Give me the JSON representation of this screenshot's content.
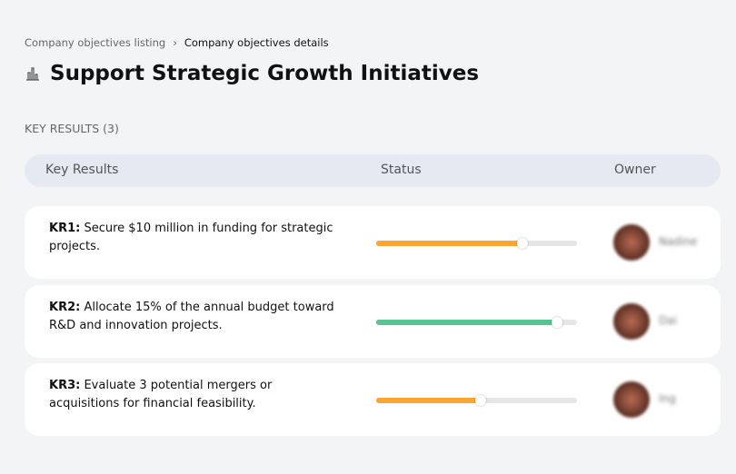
{
  "breadcrumb": {
    "parent": "Company objectives listing",
    "separator": "›",
    "current": "Company objectives details"
  },
  "page": {
    "title": "Support Strategic Growth Initiatives",
    "icon": "bar-chart-icon"
  },
  "section": {
    "label": "KEY RESULTS (3)"
  },
  "table": {
    "headers": {
      "key_results": "Key Results",
      "status": "Status",
      "owner": "Owner"
    }
  },
  "key_results": [
    {
      "id": "KR1:",
      "text": " Secure $10 million in funding for strategic projects.",
      "progress": 73,
      "color": "#fda533",
      "owner": "Nadine"
    },
    {
      "id": "KR2:",
      "text": " Allocate 15% of the annual budget toward R&D and innovation projects.",
      "progress": 90,
      "color": "#56c58f",
      "owner": "Dai"
    },
    {
      "id": "KR3:",
      "text": " Evaluate 3 potential mergers or acquisitions for financial feasibility.",
      "progress": 52,
      "color": "#fda533",
      "owner": "Ing"
    }
  ]
}
